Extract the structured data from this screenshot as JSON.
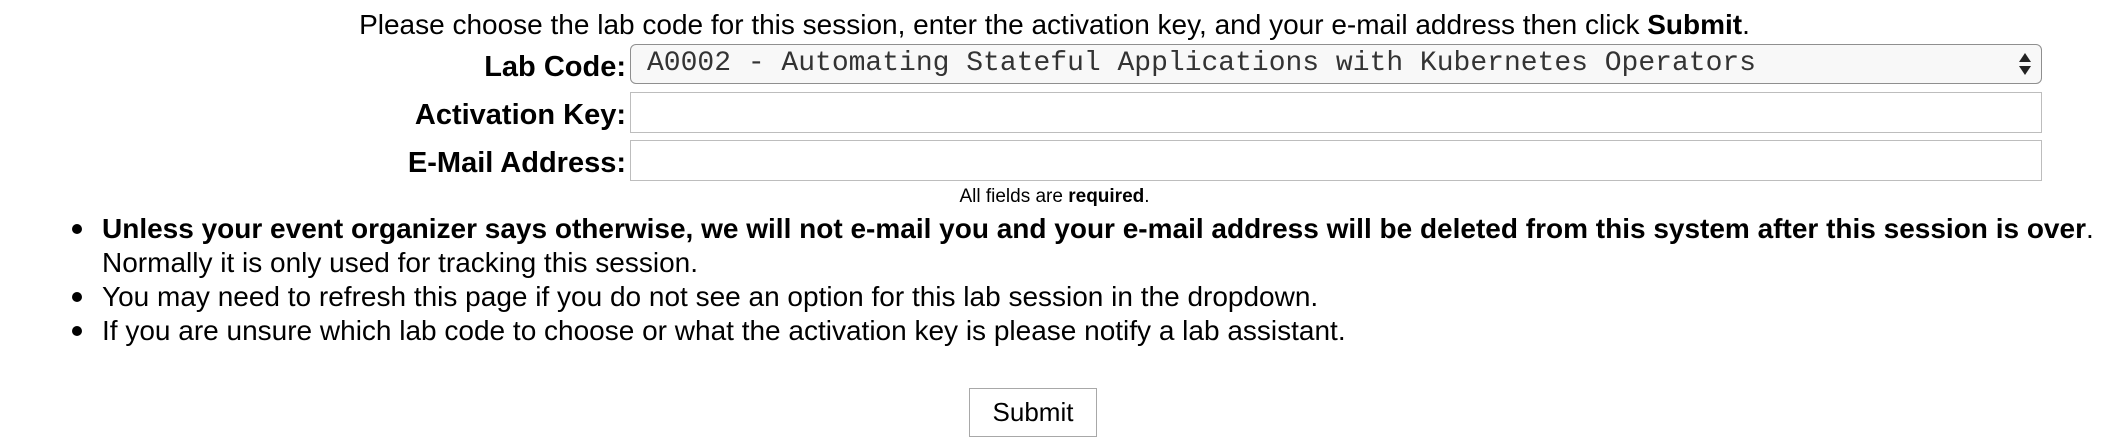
{
  "intro": {
    "text_before": "Please choose the lab code for this session, enter the activation key, and your e-mail address then click ",
    "bold": "Submit",
    "text_after": "."
  },
  "form": {
    "lab_code": {
      "label": "Lab Code:",
      "selected": "A0002 - Automating Stateful Applications with Kubernetes Operators"
    },
    "activation_key": {
      "label": "Activation Key:",
      "value": ""
    },
    "email": {
      "label": "E-Mail Address:",
      "value": ""
    },
    "required_note": {
      "before": "All fields are ",
      "bold": "required",
      "after": "."
    }
  },
  "notes": [
    {
      "bold": "Unless your event organizer says otherwise, we will not e-mail you and your e-mail address will be deleted from this system after this session is over",
      "text": ". Normally it is only used for tracking this session."
    },
    {
      "bold": "",
      "text": "You may need to refresh this page if you do not see an option for this lab session in the dropdown."
    },
    {
      "bold": "",
      "text": "If you are unsure which lab code to choose or what the activation key is please notify a lab assistant."
    }
  ],
  "submit": {
    "label": "Submit"
  },
  "icons": {
    "select_arrows": "select-arrows-icon"
  }
}
